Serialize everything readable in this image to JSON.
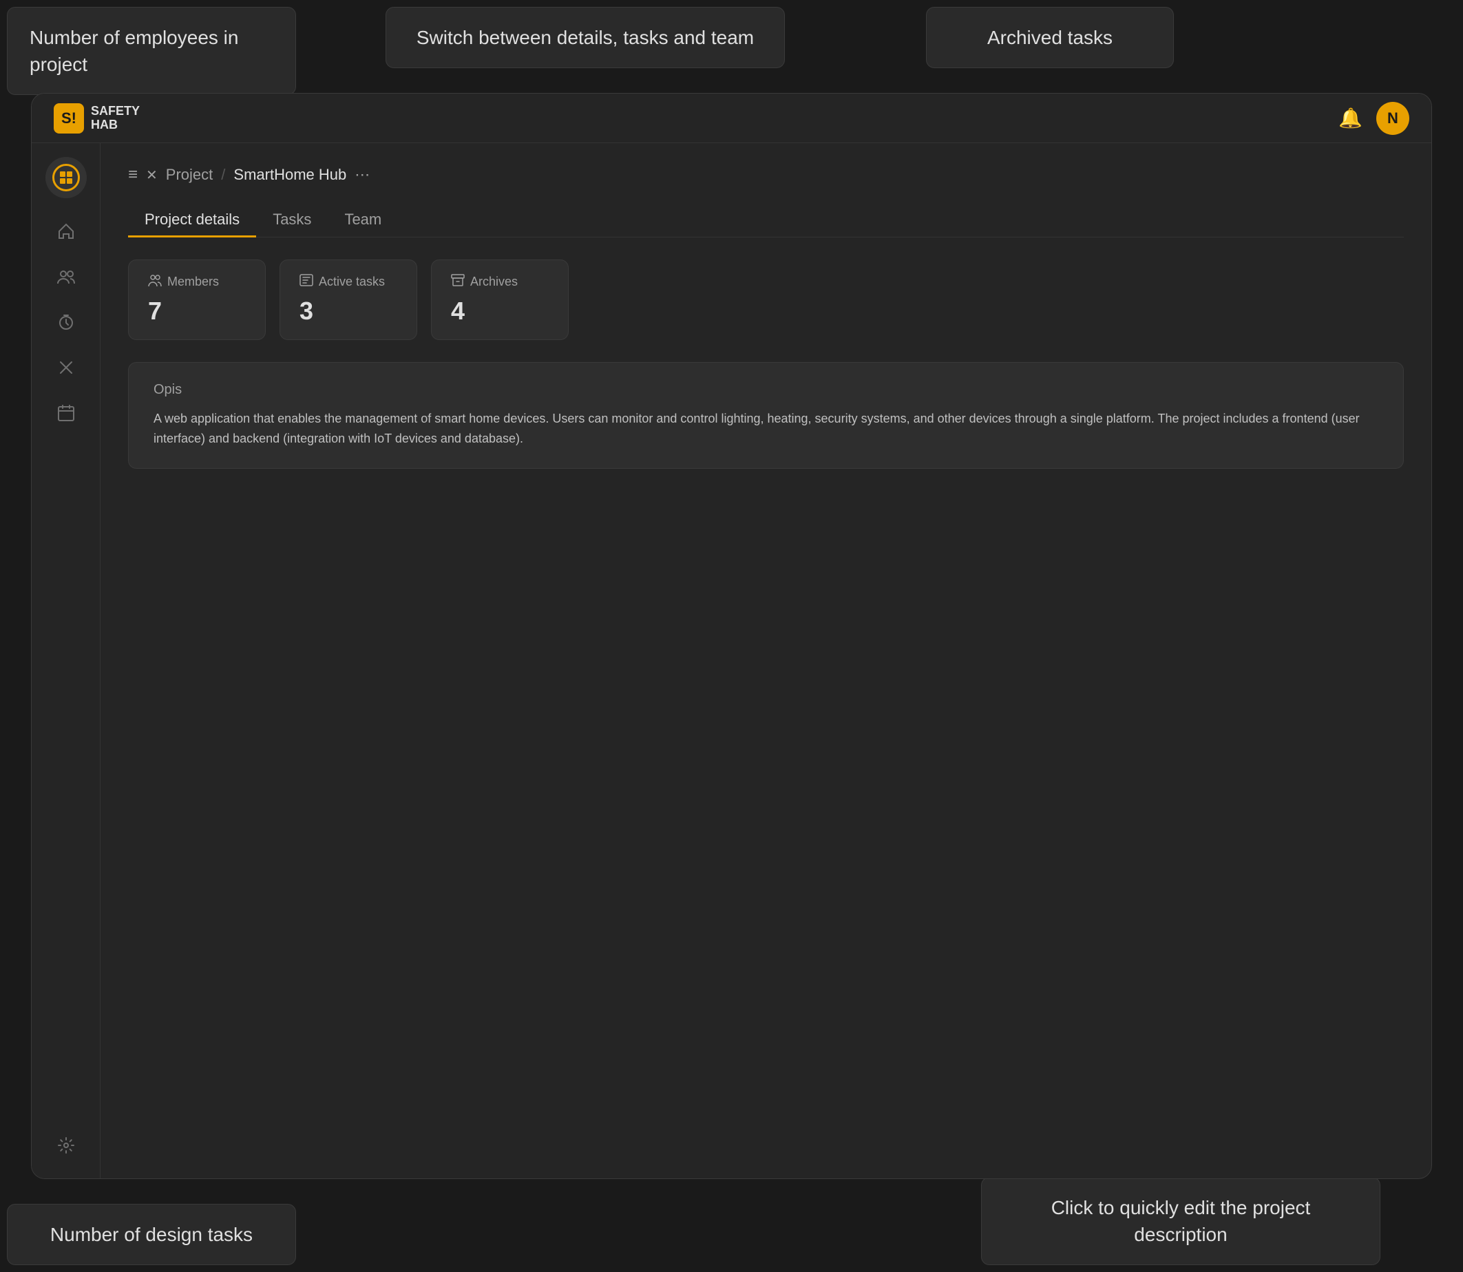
{
  "tooltips": {
    "top_left": "Number of employees in project",
    "top_center": "Switch between details, tasks and team",
    "top_right": "Archived tasks",
    "bottom_left": "Number of design tasks",
    "bottom_right": "Click to quickly edit the project description"
  },
  "app": {
    "logo_text_line1": "SAFETY",
    "logo_text_line2": "HAB",
    "avatar_letter": "N"
  },
  "breadcrumb": {
    "project_label": "Project",
    "current_project": "SmartHome Hub"
  },
  "tabs": [
    {
      "label": "Project details",
      "active": true
    },
    {
      "label": "Tasks",
      "active": false
    },
    {
      "label": "Team",
      "active": false
    }
  ],
  "stats": {
    "members": {
      "label": "Members",
      "value": "7"
    },
    "active_tasks": {
      "label": "Active tasks",
      "value": "3"
    },
    "archives": {
      "label": "Archives",
      "value": "4"
    }
  },
  "description": {
    "title": "Opis",
    "text": "A web application that enables the management of smart home devices. Users can monitor and control lighting, heating, security systems, and other devices through a single platform. The project includes a frontend (user interface) and backend (integration with IoT devices and database)."
  },
  "sidebar_icons": {
    "home": "⌂",
    "team": "👥",
    "timer": "⏱",
    "project": "✕",
    "calendar": "📅",
    "settings": "⚙"
  }
}
